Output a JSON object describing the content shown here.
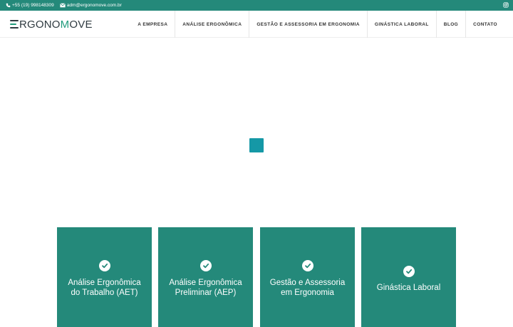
{
  "topbar": {
    "phone": "+55 (19) 998148309",
    "email": "adm@ergonomove.com.br",
    "phone_icon": "phone-icon",
    "email_icon": "envelope-icon",
    "social_icon": "instagram-icon"
  },
  "header": {
    "logo_text_1": "RGONO",
    "logo_text_2": "M",
    "logo_text_3": "OVE",
    "nav": [
      {
        "label": "A EMPRESA"
      },
      {
        "label": "ANÁLISE ERGONÔMICA"
      },
      {
        "label": "GESTÃO E ASSESSORIA EM ERGONOMIA"
      },
      {
        "label": "GINÁSTICA LABORAL"
      },
      {
        "label": "BLOG"
      },
      {
        "label": "CONTATO"
      }
    ]
  },
  "colors": {
    "primary": "#24897a",
    "loader": "#1598a6",
    "logo_green": "#1f9b7b",
    "logo_dark": "#2f3a40"
  },
  "services": [
    {
      "line1": "Análise Ergonômica",
      "line2": "do Trabalho (AET)",
      "icon": "check-circle-icon"
    },
    {
      "line1": "Análise Ergonômica",
      "line2": "Preliminar (AEP)",
      "icon": "check-circle-icon"
    },
    {
      "line1": "Gestão e Assessoria",
      "line2": "em Ergonomia",
      "icon": "check-circle-icon"
    },
    {
      "line1": "Ginástica Laboral",
      "line2": "",
      "icon": "check-circle-icon"
    }
  ]
}
